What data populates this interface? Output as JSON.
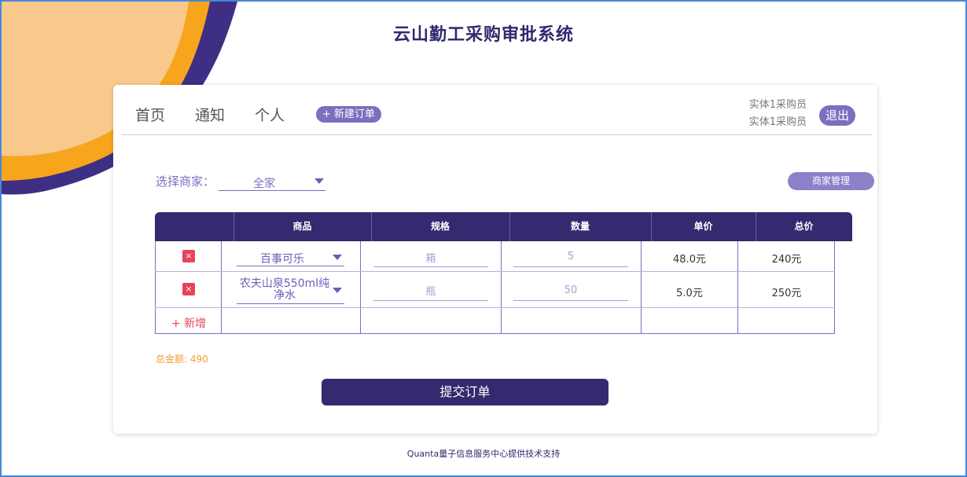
{
  "app": {
    "title": "云山勤工采购审批系统"
  },
  "nav": {
    "home": "首页",
    "notice": "通知",
    "personal": "个人",
    "new_order": "新建订单",
    "new_order_icon": "plus-icon",
    "user_line1": "实体1采购员",
    "user_line2": "实体1采购员",
    "logout": "退出"
  },
  "vendor": {
    "label": "选择商家：",
    "selected": "全家",
    "manage_button": "商家管理"
  },
  "table": {
    "headers": [
      "",
      "商品",
      "规格",
      "数量",
      "单价",
      "总价"
    ],
    "rows": [
      {
        "product": "百事可乐",
        "spec": "箱",
        "quantity": "5",
        "unit_price": "48.0元",
        "total": "240元"
      },
      {
        "product": "农夫山泉550ml纯净水",
        "spec": "瓶",
        "quantity": "50",
        "unit_price": "5.0元",
        "total": "250元"
      }
    ],
    "delete_glyph": "×",
    "add_label": "+ 新增"
  },
  "summary": {
    "total_label": "总金额: 490"
  },
  "submit": {
    "label": "提交订单"
  },
  "footer": {
    "text": "Quanta量子信息服务中心提供技术支持"
  },
  "colors": {
    "primary": "#35296f",
    "accent": "#7b6fc0",
    "danger": "#e8435a",
    "total": "#f0a030",
    "deco_orange": "#f6a51c",
    "deco_light": "#f8c98a"
  }
}
